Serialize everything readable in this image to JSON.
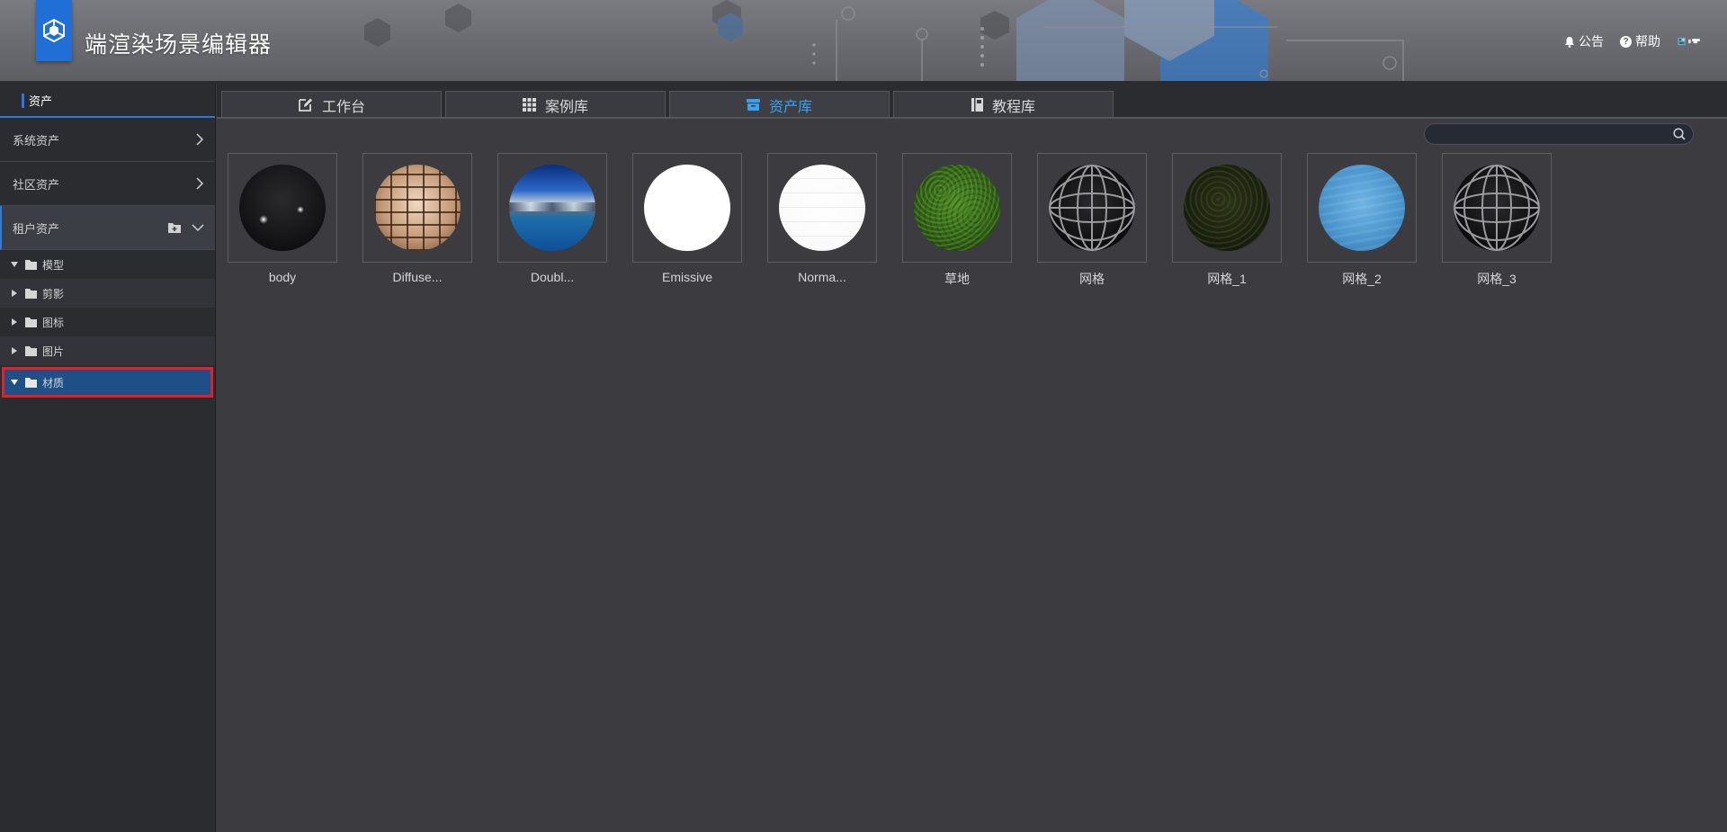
{
  "app": {
    "title": "端渲染场景编辑器",
    "logo_icon": "cube-logo-icon",
    "accent": "#1f6fd6"
  },
  "header": {
    "notice_label": "公告",
    "help_label": "帮助",
    "help_glyph": "?"
  },
  "sidebar": {
    "heading": "资产",
    "sections": [
      {
        "label": "系统资产",
        "icon": "chevron-right-icon"
      },
      {
        "label": "社区资产",
        "icon": "chevron-right-icon"
      },
      {
        "label": "租户资产",
        "icon": "chevron-down-icon",
        "extra_icon": "folder-add-icon"
      }
    ],
    "tree": [
      {
        "label": "模型",
        "expanded": true
      },
      {
        "label": "剪影",
        "expanded": false
      },
      {
        "label": "图标",
        "expanded": false
      },
      {
        "label": "图片",
        "expanded": false
      },
      {
        "label": "材质",
        "expanded": true,
        "selected": true
      }
    ]
  },
  "tabs": [
    {
      "label": "工作台",
      "icon": "edit-icon"
    },
    {
      "label": "案例库",
      "icon": "grid-icon"
    },
    {
      "label": "资产库",
      "icon": "box-icon",
      "active": true
    },
    {
      "label": "教程库",
      "icon": "book-icon"
    }
  ],
  "search": {
    "value": "",
    "placeholder": ""
  },
  "assets": [
    {
      "label": "body",
      "material": "dark-glossy"
    },
    {
      "label": "Diffuse...",
      "material": "stone-brick"
    },
    {
      "label": "Doubl...",
      "material": "sky-landscape"
    },
    {
      "label": "Emissive",
      "material": "white-emissive"
    },
    {
      "label": "Norma...",
      "material": "white-normal"
    },
    {
      "label": "草地",
      "material": "grass"
    },
    {
      "label": "网格",
      "material": "wire-grid"
    },
    {
      "label": "网格_1",
      "material": "dark-moss"
    },
    {
      "label": "网格_2",
      "material": "water"
    },
    {
      "label": "网格_3",
      "material": "wire-grid"
    }
  ]
}
